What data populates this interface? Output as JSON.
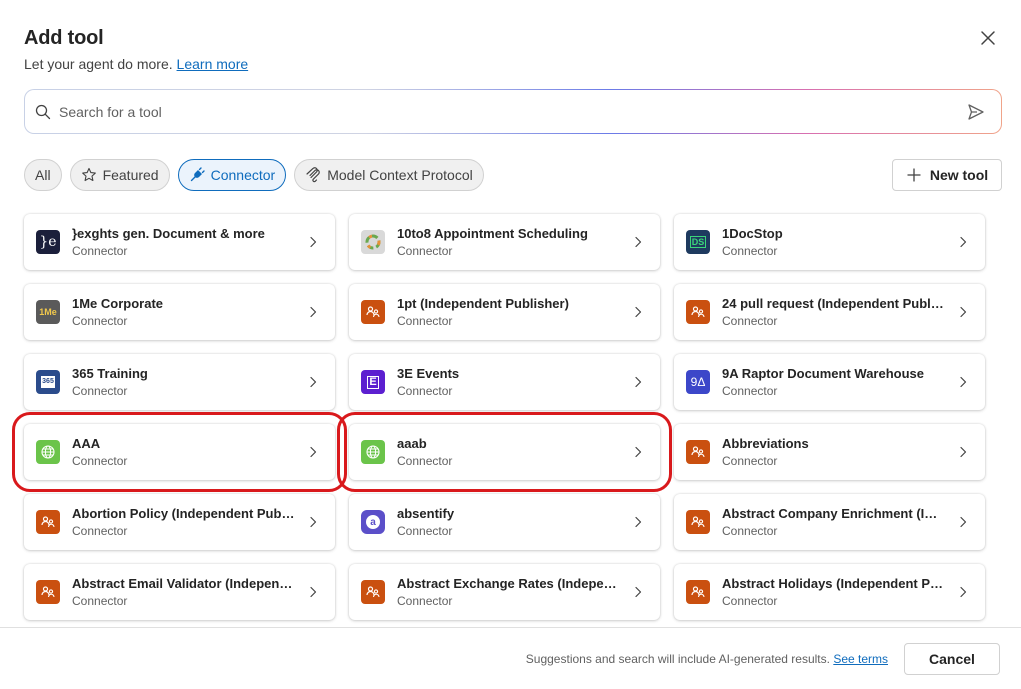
{
  "header": {
    "title": "Add tool",
    "subtitle": "Let your agent do more.",
    "learn_more": "Learn more"
  },
  "search": {
    "placeholder": "Search for a tool",
    "value": ""
  },
  "filters": [
    {
      "label": "All",
      "active": false
    },
    {
      "label": "Featured",
      "active": false
    },
    {
      "label": "Connector",
      "active": true
    },
    {
      "label": "Model Context Protocol",
      "active": false
    }
  ],
  "new_tool_label": "New tool",
  "tools": [
    {
      "name": "}exghts gen. Document & more",
      "type": "Connector",
      "icon": "je-logo",
      "color": "#1b1f3b"
    },
    {
      "name": "10to8 Appointment Scheduling",
      "type": "Connector",
      "icon": "10to8-logo",
      "color": "#d9d9d9"
    },
    {
      "name": "1DocStop",
      "type": "Connector",
      "icon": "1docstop-logo",
      "color": "#1e3a5f"
    },
    {
      "name": "1Me Corporate",
      "type": "Connector",
      "icon": "1me-logo",
      "color": "#5a5a5a"
    },
    {
      "name": "1pt (Independent Publisher)",
      "type": "Connector",
      "icon": "publisher-icon",
      "color": "#ca5010"
    },
    {
      "name": "24 pull request (Independent Publisher)",
      "type": "Connector",
      "icon": "publisher-icon",
      "color": "#ca5010"
    },
    {
      "name": "365 Training",
      "type": "Connector",
      "icon": "365-training-logo",
      "color": "#2b4c8c"
    },
    {
      "name": "3E Events",
      "type": "Connector",
      "icon": "3e-logo",
      "color": "#5c1fd0"
    },
    {
      "name": "9A Raptor Document Warehouse",
      "type": "Connector",
      "icon": "9a-logo",
      "color": "#3c47c9"
    },
    {
      "name": "AAA",
      "type": "Connector",
      "icon": "globe-icon",
      "color": "#6bc44a",
      "highlighted": true
    },
    {
      "name": "aaab",
      "type": "Connector",
      "icon": "globe-icon",
      "color": "#6bc44a",
      "highlighted": true
    },
    {
      "name": "Abbreviations",
      "type": "Connector",
      "icon": "publisher-icon",
      "color": "#ca5010"
    },
    {
      "name": "Abortion Policy (Independent Publish...",
      "type": "Connector",
      "icon": "publisher-icon",
      "color": "#ca5010"
    },
    {
      "name": "absentify",
      "type": "Connector",
      "icon": "absentify-logo",
      "color": "#5b4fc9"
    },
    {
      "name": "Abstract Company Enrichment (Indepen...",
      "type": "Connector",
      "icon": "publisher-icon",
      "color": "#ca5010"
    },
    {
      "name": "Abstract Email Validator (Independent...",
      "type": "Connector",
      "icon": "publisher-icon",
      "color": "#ca5010"
    },
    {
      "name": "Abstract Exchange Rates (Independen...",
      "type": "Connector",
      "icon": "publisher-icon",
      "color": "#ca5010"
    },
    {
      "name": "Abstract Holidays (Independent Publisher)",
      "type": "Connector",
      "icon": "publisher-icon",
      "color": "#ca5010"
    }
  ],
  "footer": {
    "note": "Suggestions and search will include AI-generated results.",
    "see_terms": "See terms",
    "cancel_label": "Cancel"
  }
}
